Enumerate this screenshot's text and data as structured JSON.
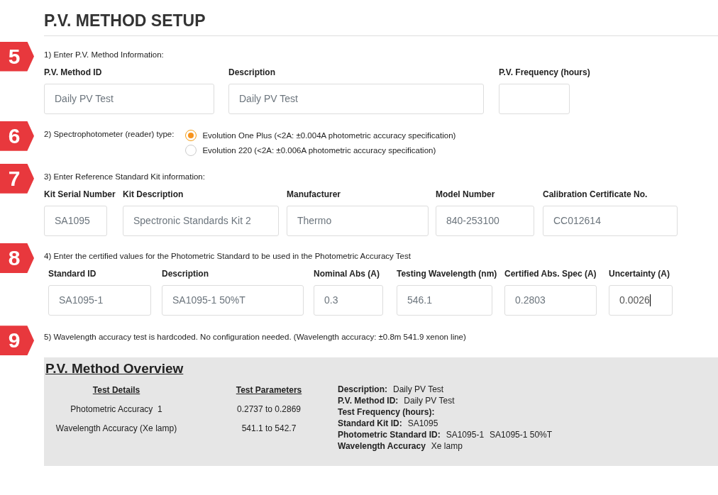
{
  "page_title": "P.V. METHOD SETUP",
  "sections": [
    {
      "marker": "5",
      "label": "1) Enter P.V. Method Information:",
      "kind": "fields",
      "fields": [
        {
          "label": "P.V. Method ID",
          "value": "Daily PV Test",
          "focused": false
        },
        {
          "label": "Description",
          "value": "Daily PV Test",
          "focused": false
        },
        {
          "label": "P.V. Frequency (hours)",
          "focused": false
        }
      ]
    },
    {
      "marker": "6",
      "label": "2) Spectrophotometer (reader) type:",
      "kind": "radios",
      "options": [
        {
          "label": "Evolution One Plus (<2A: ±0.004A photometric accuracy specification)",
          "selected": true
        },
        {
          "label": "Evolution 220 (<2A: ±0.006A photometric accuracy specification)",
          "selected": false
        }
      ]
    },
    {
      "marker": "7",
      "label": "3) Enter Reference Standard Kit information:",
      "kind": "fields",
      "fields": [
        {
          "label": "Kit Serial Number",
          "value": "SA1095",
          "focused": false
        },
        {
          "label": "Kit Description",
          "value": "Spectronic Standards Kit 2",
          "focused": false
        },
        {
          "label": "Manufacturer",
          "value": "Thermo",
          "focused": false
        },
        {
          "label": "Model Number",
          "value": "840-253100",
          "focused": false
        },
        {
          "label": "Calibration Certificate No.",
          "value": "CC012614",
          "focused": false
        }
      ]
    },
    {
      "marker": "8",
      "label": "4) Enter the certified values for the Photometric Standard to be used in the Photometric Accuracy Test",
      "kind": "fields",
      "fields": [
        {
          "label": "Standard ID",
          "value": "SA1095-1",
          "focused": false
        },
        {
          "label": "Description",
          "value": "SA1095-1 50%T",
          "focused": false
        },
        {
          "label": "Nominal Abs (A)",
          "value": "0.3",
          "focused": false
        },
        {
          "label": "Testing Wavelength (nm)",
          "value": "546.1",
          "focused": false
        },
        {
          "label": "Certified Abs. Spec (A)",
          "value": "0.2803",
          "focused": false
        },
        {
          "label": "Uncertainty (A)",
          "value": "0.0026",
          "focused": true
        }
      ]
    },
    {
      "marker": "9",
      "label": "5) Wavelength accuracy test is hardcoded. No configuration needed. (Wavelength accuracy: ±0.8m 541.9 xenon line)",
      "kind": "note"
    }
  ],
  "overview": {
    "title": "P.V. Method Overview",
    "columns": [
      "Test Details",
      "Test Parameters"
    ],
    "rows": [
      [
        "Photometric Accuracy  1",
        "0.2737 to 0.2869"
      ],
      [
        "Wavelength Accuracy (Xe lamp)",
        "541.1 to 542.7"
      ]
    ],
    "summary": [
      {
        "key": "Description:",
        "values": [
          "Daily PV Test"
        ]
      },
      {
        "key": "P.V. Method ID:",
        "values": [
          "Daily PV Test"
        ]
      },
      {
        "key": "Test Frequency (hours):"
      },
      {
        "key": "Standard Kit ID:",
        "values": [
          "SA1095"
        ]
      },
      {
        "key": "Photometric Standard ID:",
        "values": [
          "SA1095-1",
          "SA1095-1 50%T"
        ]
      },
      {
        "key": "Wavelength Accuracy",
        "values": [
          "Xe lamp"
        ]
      }
    ]
  }
}
